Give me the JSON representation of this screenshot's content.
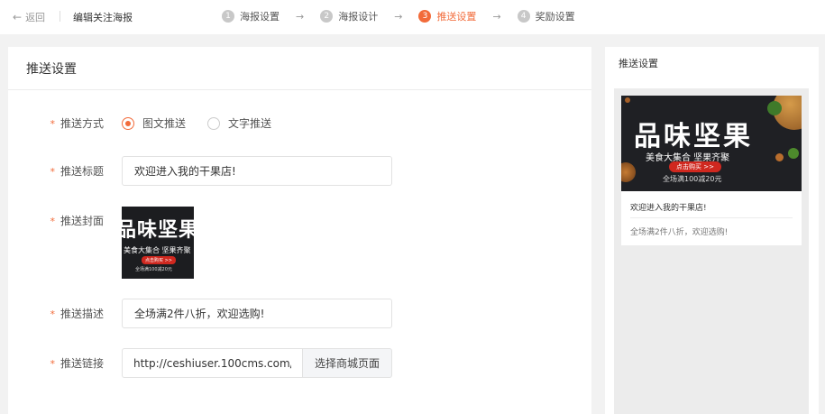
{
  "topbar": {
    "back_label": "返回",
    "title": "编辑关注海报",
    "steps": [
      {
        "num": "1",
        "label": "海报设置"
      },
      {
        "num": "2",
        "label": "海报设计"
      },
      {
        "num": "3",
        "label": "推送设置"
      },
      {
        "num": "4",
        "label": "奖励设置"
      }
    ],
    "active_step": 3,
    "accent_color": "#f26b3a"
  },
  "main": {
    "heading": "推送设置",
    "fields": {
      "method": {
        "label": "推送方式",
        "options": [
          "图文推送",
          "文字推送"
        ],
        "selected": "图文推送"
      },
      "title": {
        "label": "推送标题",
        "value": "欢迎进入我的干果店!"
      },
      "cover": {
        "label": "推送封面",
        "big": "品味坚果",
        "sub": "美食大集合 坚果齐聚",
        "btn": "点击购买 >>",
        "small": "全场满100减20元"
      },
      "description": {
        "label": "推送描述",
        "value": "全场满2件八折，欢迎选购!"
      },
      "link": {
        "label": "推送链接",
        "value": "http://ceshiuser.100cms.com/",
        "button": "选择商城页面"
      }
    }
  },
  "preview": {
    "heading": "推送设置",
    "banner": {
      "big": "品味坚果",
      "sub": "美食大集合 坚果齐聚",
      "btn": "点击购买 >>",
      "small": "全场满100减20元"
    },
    "title": "欢迎进入我的干果店!",
    "description": "全场满2件八折，欢迎选购!"
  }
}
